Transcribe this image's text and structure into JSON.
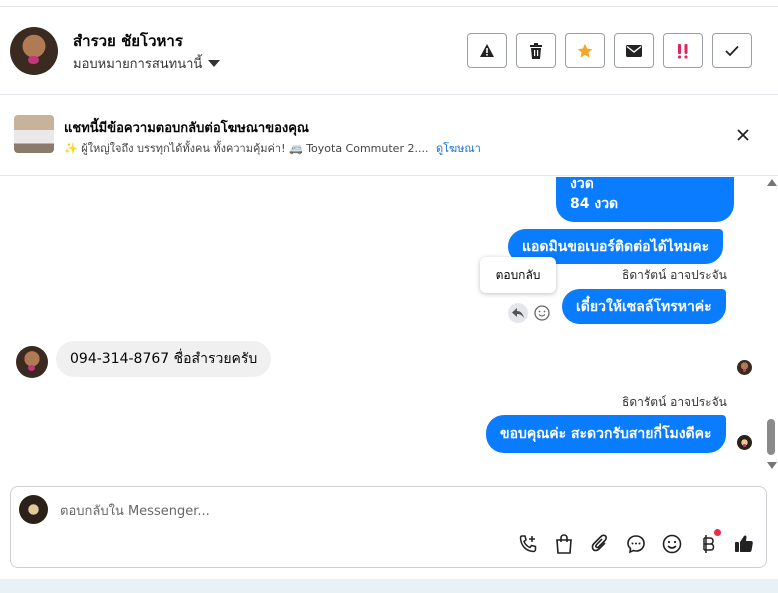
{
  "header": {
    "name": "สำรวย ชัยโวหาร",
    "assigned": "มอบหมายการสนทนานี้",
    "actions": [
      "warning-icon",
      "trash-icon",
      "star-icon",
      "envelope-icon",
      "double-exclamation-icon",
      "check-icon"
    ]
  },
  "ad": {
    "title": "แชทนี้มีข้อความตอบกลับต่อโฆษณาของคุณ",
    "description": "✨ ผู้ใหญ่ใจถึง บรรทุกได้ทั้งคน ทั้งความคุ้มค่า! 🚐 Toyota Commuter 2....",
    "link": "ดูโฆษณา"
  },
  "messages": {
    "m1_line1": "งวด",
    "m1_line2": "84 งวด",
    "m2": "แอดมินขอเบอร์ติดต่อได้ไหมคะ",
    "sender1": "ธิดารัตน์ อาจประจัน",
    "m3": "เดี๋ยวให้เซลล์โทรหาค่ะ",
    "tooltip": "ตอบกลับ",
    "m4": "094-314-8767 ชื่อสำรวยครับ",
    "sender2": "ธิดารัตน์ อาจประจัน",
    "m5": "ขอบคุณค่ะ สะดวกรับสายกี่โมงดีคะ"
  },
  "composer": {
    "placeholder": "ตอบกลับใน Messenger..."
  },
  "colors": {
    "outgoing_bubble": "#0a7cff",
    "incoming_bubble": "#f0f0f0",
    "star": "#f5a623",
    "alert": "#e0245e"
  }
}
